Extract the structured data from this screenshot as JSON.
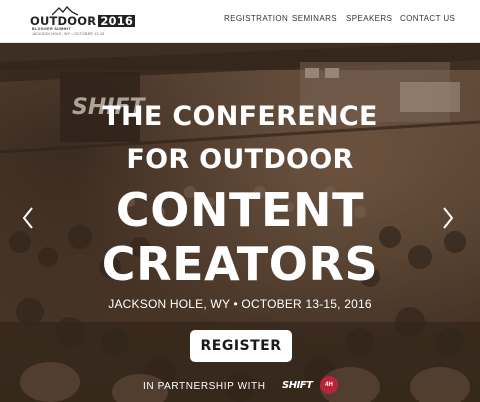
{
  "logo": {
    "title": "OUTDOOR",
    "year": "2016",
    "subtitle": "BLOGGER SUMMIT",
    "tagline": "JACKSON HOLE, WY • OCTOBER 13-15"
  },
  "nav": {
    "items": [
      {
        "label": "REGISTRATION"
      },
      {
        "label": "SEMINARS"
      },
      {
        "label": "SPEAKERS"
      },
      {
        "label": "CONTACT US"
      }
    ]
  },
  "hero": {
    "headline_lines": [
      "THE CONFERENCE",
      "FOR OUTDOOR",
      "CONTENT",
      "CREATORS"
    ],
    "event_info": "JACKSON HOLE, WY • OCTOBER 13-15, 2016",
    "register_label": "REGISTER",
    "partnership_label": "IN PARTNERSHIP WITH",
    "partners": [
      "SHIFT",
      "4H"
    ],
    "background_text": "SHIFT"
  },
  "colors": {
    "overlay": "#5a4536",
    "text_light": "#ffffff",
    "button_bg": "#ffffff",
    "button_text": "#1a1a1a",
    "partner_badge": "#b8253a"
  }
}
